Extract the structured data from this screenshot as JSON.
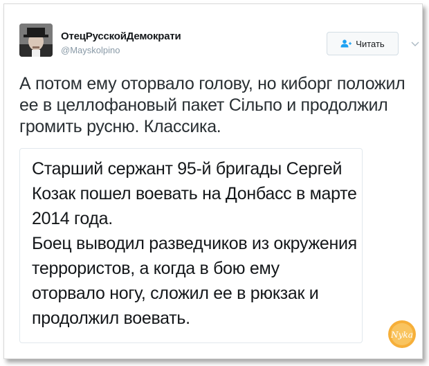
{
  "author": {
    "name": "ОтецРусскойДемократи",
    "handle": "@Mayskolpino"
  },
  "follow_button": {
    "label": "Читать",
    "icon": "add-user-icon"
  },
  "tweet": {
    "text": "А потом ему оторвало голову, но киборг положил ее в целлофановый пакет Сільпо и продолжил громить русню. Классика."
  },
  "quote": {
    "text": "Старший сержант 95-й бригады Сергей Козак пошел воевать на Донбасс в марте 2014 года.\nБоец выводил разведчиков из окружения террористов, а когда в бою ему оторвало ногу, сложил ее в рюкзак и продолжил воевать."
  },
  "watermark": {
    "logo_text": "Nyka",
    "colors": {
      "main": "#f5a623",
      "light": "#fcd27a"
    }
  },
  "colors": {
    "text": "#14171a",
    "muted": "#8899a6",
    "border": "#e1e8ed",
    "accent": "#1da1f2"
  }
}
